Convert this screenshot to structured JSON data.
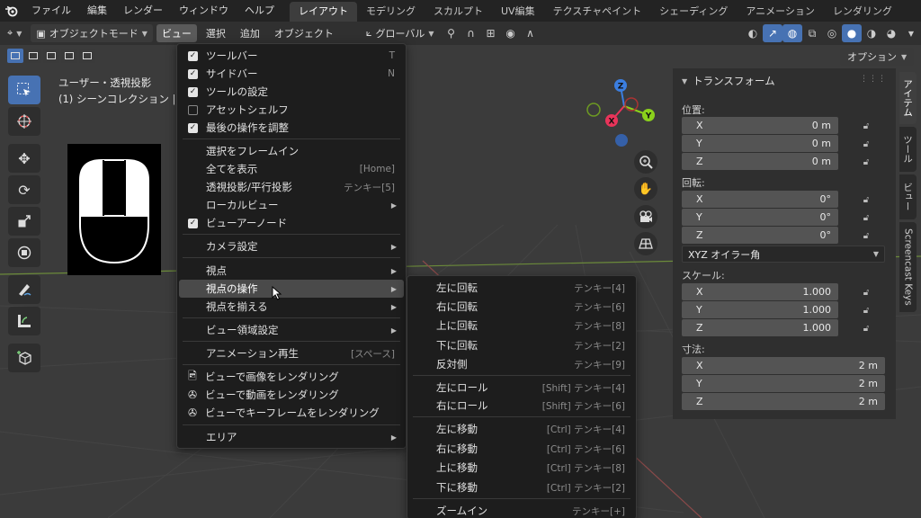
{
  "topbar": {
    "menus": [
      "ファイル",
      "編集",
      "レンダー",
      "ウィンドウ",
      "ヘルプ"
    ],
    "workspaces": [
      "レイアウト",
      "モデリング",
      "スカルプト",
      "UV編集",
      "テクスチャペイント",
      "シェーディング",
      "アニメーション",
      "レンダリング"
    ],
    "active_workspace": "レイアウト"
  },
  "header": {
    "mode": "オブジェクトモード",
    "menus": [
      "ビュー",
      "選択",
      "追加",
      "オブジェクト"
    ],
    "active_menu": "ビュー",
    "orientation": "グローバル",
    "options_label": "オプション"
  },
  "viewport": {
    "view_name": "ユーザー・透視投影",
    "collection": "(1) シーンコレクション |"
  },
  "gizmo": {
    "z": "Z",
    "x": "X",
    "y": "Y"
  },
  "npanel": {
    "title": "トランスフォーム",
    "location_label": "位置:",
    "location": [
      {
        "axis": "X",
        "value": "0 m"
      },
      {
        "axis": "Y",
        "value": "0 m"
      },
      {
        "axis": "Z",
        "value": "0 m"
      }
    ],
    "rotation_label": "回転:",
    "rotation": [
      {
        "axis": "X",
        "value": "0°"
      },
      {
        "axis": "Y",
        "value": "0°"
      },
      {
        "axis": "Z",
        "value": "0°"
      }
    ],
    "rotation_mode": "XYZ オイラー角",
    "scale_label": "スケール:",
    "scale": [
      {
        "axis": "X",
        "value": "1.000"
      },
      {
        "axis": "Y",
        "value": "1.000"
      },
      {
        "axis": "Z",
        "value": "1.000"
      }
    ],
    "dimensions_label": "寸法:",
    "dimensions": [
      {
        "axis": "X",
        "value": "2 m"
      },
      {
        "axis": "Y",
        "value": "2 m"
      },
      {
        "axis": "Z",
        "value": "2 m"
      }
    ]
  },
  "sidetabs": [
    "アイテム",
    "ツール",
    "ビュー",
    "Screencast Keys"
  ],
  "view_menu": {
    "items": [
      {
        "label": "ツールバー",
        "shortcut": "T",
        "check": true
      },
      {
        "label": "サイドバー",
        "shortcut": "N",
        "check": true
      },
      {
        "label": "ツールの設定",
        "shortcut": "",
        "check": true
      },
      {
        "label": "アセットシェルフ",
        "shortcut": "",
        "check": false
      },
      {
        "label": "最後の操作を調整",
        "shortcut": "",
        "check": true
      },
      {
        "label": "選択をフレームイン",
        "shortcut": ""
      },
      {
        "label": "全てを表示",
        "shortcut": "[Home]"
      },
      {
        "label": "透視投影/平行投影",
        "shortcut": "テンキー[5]"
      },
      {
        "label": "ローカルビュー",
        "shortcut": "",
        "submenu": true
      },
      {
        "label": "ビューアーノード",
        "shortcut": "",
        "check": true
      },
      {
        "label": "カメラ設定",
        "shortcut": "",
        "submenu": true
      },
      {
        "label": "視点",
        "shortcut": "",
        "submenu": true
      },
      {
        "label": "視点の操作",
        "shortcut": "",
        "submenu": true
      },
      {
        "label": "視点を揃える",
        "shortcut": "",
        "submenu": true
      },
      {
        "label": "ビュー領域設定",
        "shortcut": "",
        "submenu": true
      },
      {
        "label": "アニメーション再生",
        "shortcut": "[スペース]"
      },
      {
        "label": "ビューで画像をレンダリング",
        "shortcut": ""
      },
      {
        "label": "ビューで動画をレンダリング",
        "shortcut": ""
      },
      {
        "label": "ビューでキーフレームをレンダリング",
        "shortcut": ""
      },
      {
        "label": "エリア",
        "shortcut": "",
        "submenu": true
      }
    ],
    "highlighted": "視点の操作"
  },
  "navigation_submenu": {
    "items": [
      {
        "label": "左に回転",
        "shortcut": "テンキー[4]"
      },
      {
        "label": "右に回転",
        "shortcut": "テンキー[6]"
      },
      {
        "label": "上に回転",
        "shortcut": "テンキー[8]"
      },
      {
        "label": "下に回転",
        "shortcut": "テンキー[2]"
      },
      {
        "label": "反対側",
        "shortcut": "テンキー[9]"
      },
      {
        "label": "左にロール",
        "shortcut": "[Shift] テンキー[4]"
      },
      {
        "label": "右にロール",
        "shortcut": "[Shift] テンキー[6]"
      },
      {
        "label": "左に移動",
        "shortcut": "[Ctrl] テンキー[4]"
      },
      {
        "label": "右に移動",
        "shortcut": "[Ctrl] テンキー[6]"
      },
      {
        "label": "上に移動",
        "shortcut": "[Ctrl] テンキー[8]"
      },
      {
        "label": "下に移動",
        "shortcut": "[Ctrl] テンキー[2]"
      },
      {
        "label": "ズームイン",
        "shortcut": "テンキー[+]"
      }
    ]
  },
  "icons": [
    "blender-logo-icon",
    "checkmark-icon",
    "chevron-down-icon",
    "chevron-right-icon",
    "lock-icon",
    "zoom-icon",
    "hand-icon",
    "camera-icon",
    "grid-icon",
    "cursor-icon",
    "move-icon",
    "rotate-icon",
    "scale-icon",
    "transform-icon",
    "annotate-icon",
    "measure-icon",
    "add-cube-icon",
    "select-box-icon",
    "render-image-icon",
    "render-movie-icon"
  ],
  "colors": {
    "accent": "#4772b3",
    "x_axis": "#e8345a",
    "y_axis": "#8bd11c",
    "z_axis": "#3b7ee0"
  }
}
